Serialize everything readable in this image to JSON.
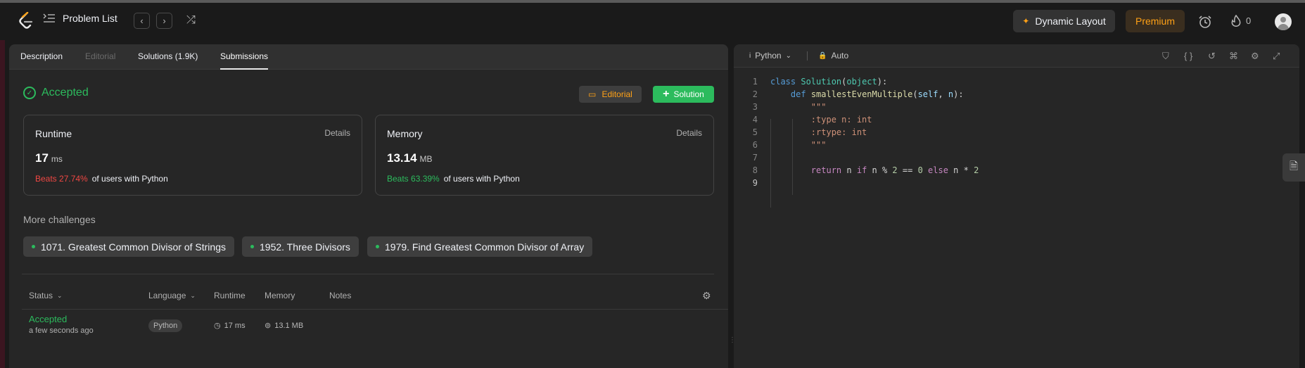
{
  "topbar": {
    "problem_list_label": "Problem List",
    "prev_icon": "‹",
    "next_icon": "›",
    "shuffle_icon": "⤮",
    "dynamic_layout_label": "Dynamic Layout",
    "premium_label": "Premium",
    "streak_count": "0"
  },
  "tabs": {
    "description": "Description",
    "editorial": "Editorial",
    "solutions": "Solutions (1.9K)",
    "submissions": "Submissions"
  },
  "result": {
    "status": "Accepted",
    "editorial_button": "Editorial",
    "solution_button": "Solution"
  },
  "runtime_card": {
    "title": "Runtime",
    "details": "Details",
    "value": "17",
    "unit": "ms",
    "beats": "Beats 27.74%",
    "suffix": "of users with Python"
  },
  "memory_card": {
    "title": "Memory",
    "details": "Details",
    "value": "13.14",
    "unit": "MB",
    "beats": "Beats 63.39%",
    "suffix": "of users with Python"
  },
  "challenges": {
    "heading": "More challenges",
    "items": [
      "1071. Greatest Common Divisor of Strings",
      "1952. Three Divisors",
      "1979. Find Greatest Common Divisor of Array"
    ]
  },
  "table": {
    "headers": {
      "status": "Status",
      "language": "Language",
      "runtime": "Runtime",
      "memory": "Memory",
      "notes": "Notes"
    },
    "row": {
      "status": "Accepted",
      "time": "a few seconds ago",
      "language": "Python",
      "runtime": "17 ms",
      "memory": "13.1 MB"
    }
  },
  "editor": {
    "language": "Python",
    "mode": "Auto",
    "line_numbers": [
      "1",
      "2",
      "3",
      "4",
      "5",
      "6",
      "7",
      "8",
      "9"
    ]
  },
  "colors": {
    "accepted": "#2cbb5d",
    "accent": "#ffa116",
    "beats_low": "#ef4743"
  }
}
